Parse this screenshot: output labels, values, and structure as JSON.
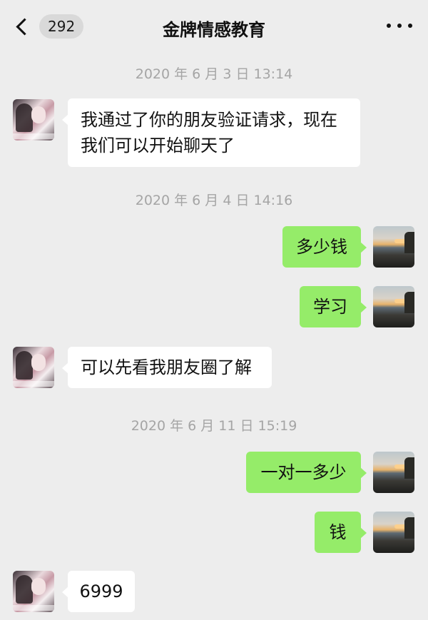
{
  "header": {
    "back_count": "292",
    "title": "金牌情感教育"
  },
  "messages": [
    {
      "type": "timestamp",
      "text": "2020 年 6 月 3 日 13:14"
    },
    {
      "type": "in",
      "text": "我通过了你的朋友验证请求，现在我们可以开始聊天了"
    },
    {
      "type": "timestamp",
      "text": "2020 年 6 月 4 日 14:16"
    },
    {
      "type": "out",
      "text": "多少钱"
    },
    {
      "type": "out",
      "text": "学习"
    },
    {
      "type": "in",
      "text": "可以先看我朋友圈了解"
    },
    {
      "type": "timestamp",
      "text": "2020 年 6 月 11 日 15:19"
    },
    {
      "type": "out",
      "text": "一对一多少"
    },
    {
      "type": "out",
      "text": "钱"
    },
    {
      "type": "in",
      "text": "6999"
    }
  ],
  "colors": {
    "background": "#ededed",
    "outgoing_bubble": "#95ec69",
    "incoming_bubble": "#ffffff",
    "timestamp_text": "#a5a5a5"
  },
  "icons": {
    "back": "chevron-left-icon",
    "more": "more-dots-icon"
  }
}
